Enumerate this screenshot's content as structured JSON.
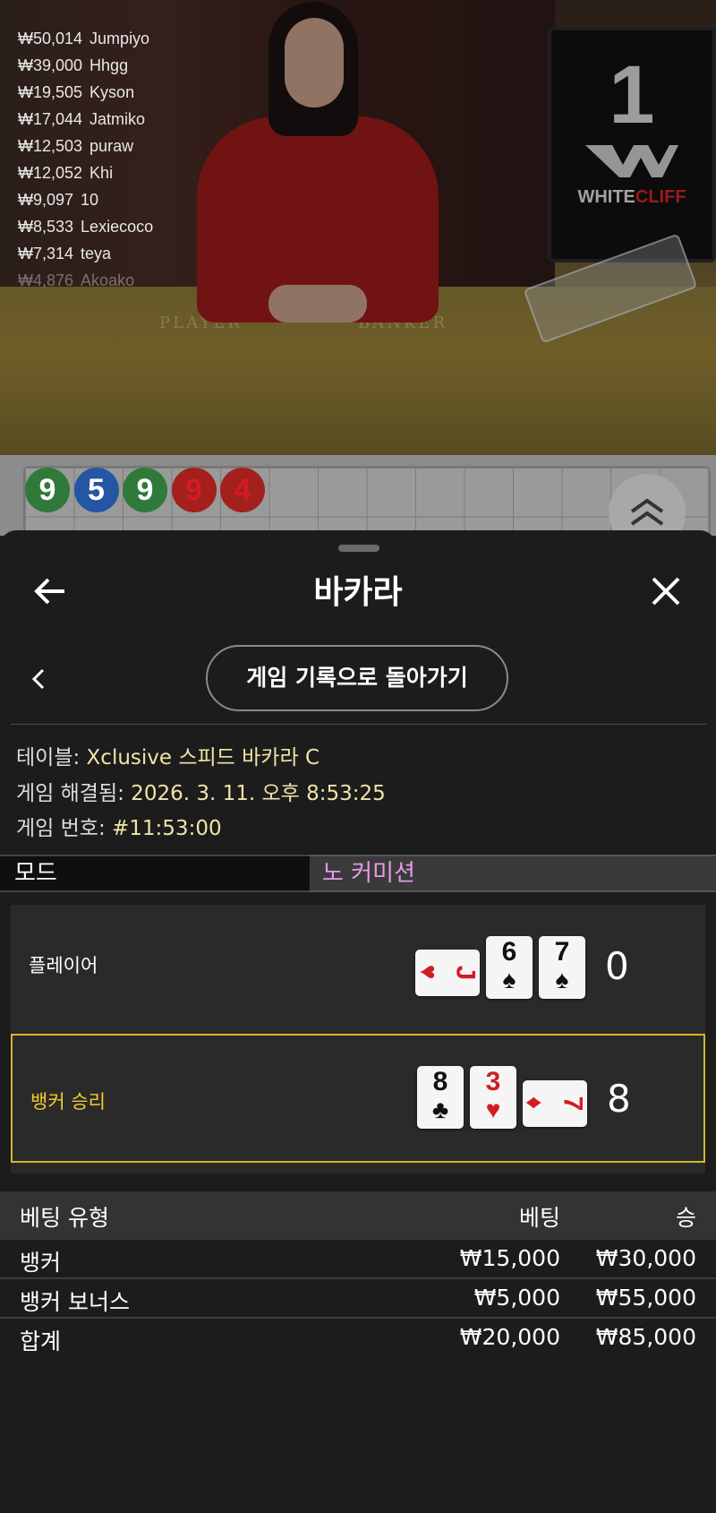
{
  "video": {
    "monitor_number": "1",
    "monitor_logo_white": "WHITE",
    "monitor_logo_red": "CLIFF",
    "felt_player": "PLAYER",
    "felt_banker": "BANKER",
    "leaderboard": [
      {
        "amount": "₩50,014",
        "name": "Jumpiyo"
      },
      {
        "amount": "₩39,000",
        "name": "Hhgg"
      },
      {
        "amount": "₩19,505",
        "name": "Kyson"
      },
      {
        "amount": "₩17,044",
        "name": "Jatmiko"
      },
      {
        "amount": "₩12,503",
        "name": "puraw"
      },
      {
        "amount": "₩12,052",
        "name": "Khi"
      },
      {
        "amount": "₩9,097",
        "name": "10"
      },
      {
        "amount": "₩8,533",
        "name": "Lexiecoco"
      },
      {
        "amount": "₩7,314",
        "name": "teya"
      },
      {
        "amount": "₩4,876",
        "name": "Akoako"
      }
    ]
  },
  "roadmap": {
    "beads": [
      {
        "value": "9",
        "color": "green"
      },
      {
        "value": "5",
        "color": "blue"
      },
      {
        "value": "9",
        "color": "green"
      },
      {
        "value": "9",
        "color": "red"
      },
      {
        "value": "4",
        "color": "red"
      }
    ]
  },
  "header": {
    "title": "바카라"
  },
  "nav": {
    "back_to_history": "게임 기록으로 돌아가기"
  },
  "info": {
    "table_label": "테이블:",
    "table_value": " Xclusive 스피드 바카라 C",
    "resolved_label": "게임 해결됨:",
    "resolved_value": " 2026. 3. 11. 오후 8:53:25",
    "number_label": "게임 번호:",
    "number_value": " #11:53:00"
  },
  "mode": {
    "label": "모드",
    "value": "노 커미션"
  },
  "hands": {
    "player": {
      "label": "플레이어",
      "score": "0",
      "cards": [
        {
          "rank": "J",
          "suit": "♥",
          "color": "red",
          "orient": "h"
        },
        {
          "rank": "6",
          "suit": "♠",
          "color": "blk",
          "orient": "v"
        },
        {
          "rank": "7",
          "suit": "♠",
          "color": "blk",
          "orient": "v"
        }
      ]
    },
    "banker": {
      "label": "뱅커 승리",
      "score": "8",
      "cards": [
        {
          "rank": "8",
          "suit": "♣",
          "color": "blk",
          "orient": "v"
        },
        {
          "rank": "3",
          "suit": "♥",
          "color": "red",
          "orient": "v"
        },
        {
          "rank": "7",
          "suit": "♦",
          "color": "red",
          "orient": "h"
        }
      ]
    }
  },
  "bets": {
    "headers": {
      "type": "베팅 유형",
      "bet": "베팅",
      "win": "승"
    },
    "rows": [
      {
        "type": "뱅커",
        "bet": "₩15,000",
        "win": "₩30,000"
      },
      {
        "type": "뱅커 보너스",
        "bet": "₩5,000",
        "win": "₩55,000"
      }
    ],
    "total": {
      "type": "합계",
      "bet": "₩20,000",
      "win": "₩85,000"
    }
  },
  "colors": {
    "win_border": "#d8b526",
    "mode_value": "#e69ae8",
    "info_value": "#f0e4a8"
  }
}
